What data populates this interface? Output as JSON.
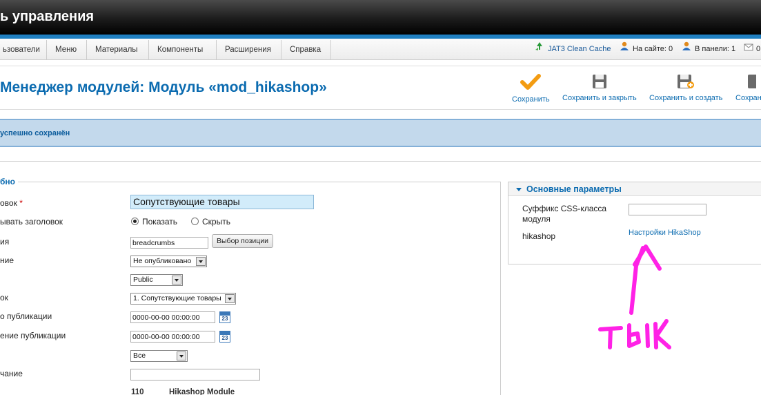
{
  "header": {
    "title": "ь управления"
  },
  "menubar": {
    "items": [
      "ьзователи",
      "Меню",
      "Материалы",
      "Компоненты",
      "Расширения",
      "Справка"
    ],
    "status": {
      "cache": "JAT3 Clean Cache",
      "online": "На сайте: 0",
      "panel": "В панели: 1",
      "messages": "0"
    }
  },
  "toolbar": {
    "title": "Менеджер модулей: Модуль «mod_hikashop»",
    "save": "Сохранить",
    "save_close": "Сохранить и закрыть",
    "save_new": "Сохранить и создать",
    "save_copy": "Сохран"
  },
  "message": "успешно сохранён",
  "details": {
    "legend": "бно",
    "title_label": "овок",
    "title_required": "*",
    "title_value": "Сопутствующие товары",
    "show_title_label": "ывать заголовок",
    "show_option": "Показать",
    "hide_option": "Скрыть",
    "position_label": "ия",
    "position_value": "breadcrumbs",
    "position_button": "Выбор позиции",
    "status_label": "ние",
    "status_value": "Не опубликовано",
    "access_value": "Public",
    "order_label": "ок",
    "order_value": "1. Сопутствующие товары",
    "publish_start_label": "о публикации",
    "publish_start_value": "0000-00-00 00:00:00",
    "publish_end_label": "ение публикации",
    "publish_end_value": "0000-00-00 00:00:00",
    "language_value": "Все",
    "note_label": "чание",
    "calendar_day": "23",
    "module_id": "110",
    "module_type": "Hikashop Module"
  },
  "params": {
    "title": "Основные параметры",
    "css_label": "Суффикс CSS-класса модуля",
    "hikashop_label": "hikashop",
    "hikashop_link": "Настройки HikaShop"
  },
  "annotation": {
    "text": "ТЫК",
    "color": "#ff22e6"
  },
  "colors": {
    "accent": "#0b6bb0",
    "header": "#111111",
    "stripe": "#1f7fc0",
    "message_bg": "#c3d9ec"
  }
}
